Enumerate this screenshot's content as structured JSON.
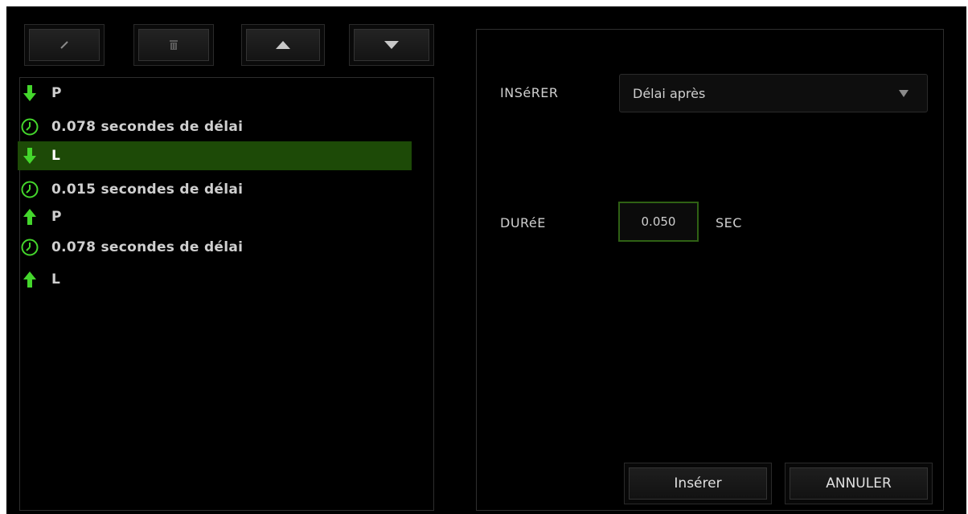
{
  "toolbar": {
    "edit_icon": "pencil-icon",
    "delete_icon": "trash-icon",
    "up_icon": "triangle-up-icon",
    "down_icon": "triangle-down-icon"
  },
  "macro_list": {
    "items": [
      {
        "icon": "arrow-down-icon",
        "text": "P"
      },
      {
        "icon": "clock-icon",
        "text": "0.078 secondes de délai"
      },
      {
        "icon": "arrow-down-icon",
        "text": "L",
        "selected": true
      },
      {
        "icon": "clock-icon",
        "text": "0.015 secondes de délai"
      },
      {
        "icon": "arrow-up-icon",
        "text": "P"
      },
      {
        "icon": "clock-icon",
        "text": "0.078 secondes de délai"
      },
      {
        "icon": "arrow-up-icon",
        "text": "L"
      }
    ]
  },
  "form": {
    "insert_label": "INSéRER",
    "insert_value": "Délai après",
    "duration_label": "DURéE",
    "duration_value": "0.050",
    "duration_unit": "SEC"
  },
  "actions": {
    "insert_label": "Insérer",
    "cancel_label": "ANNULER"
  },
  "colors": {
    "accent": "#44d62c",
    "selection": "#1d4a07",
    "background": "#000000"
  }
}
